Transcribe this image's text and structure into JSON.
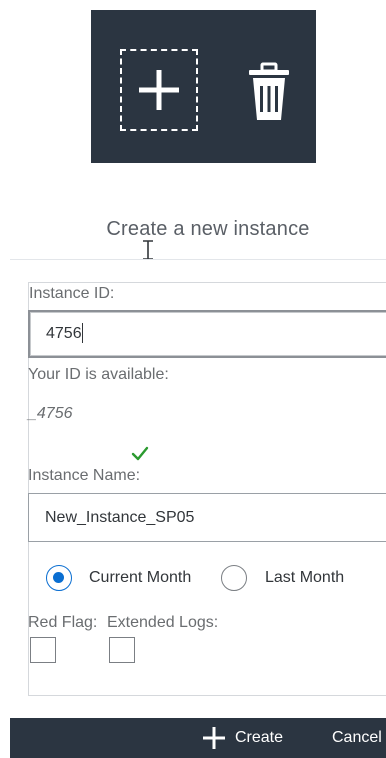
{
  "toolbar": {
    "add_icon": "plus-icon",
    "delete_icon": "trash-icon"
  },
  "dialog": {
    "title": "Create a new instance",
    "instance_id": {
      "label": "Instance ID:",
      "value": "4756",
      "availability_text": "Your ID is available:",
      "preview_id": "_4756"
    },
    "instance_name": {
      "label": "Instance Name:",
      "value": "New_Instance_SP05"
    },
    "period": {
      "options": [
        "Current Month",
        "Last Month"
      ],
      "selected": "Current Month"
    },
    "flags": {
      "red_flag_label": "Red Flag:",
      "extended_logs_label": "Extended Logs:",
      "red_flag_checked": false,
      "extended_logs_checked": false
    },
    "footer": {
      "create_label": "Create",
      "cancel_label": "Cancel"
    }
  },
  "colors": {
    "toolbar_bg": "#2b3541",
    "accent": "#0a6ed1",
    "success": "#2b9a2f"
  }
}
